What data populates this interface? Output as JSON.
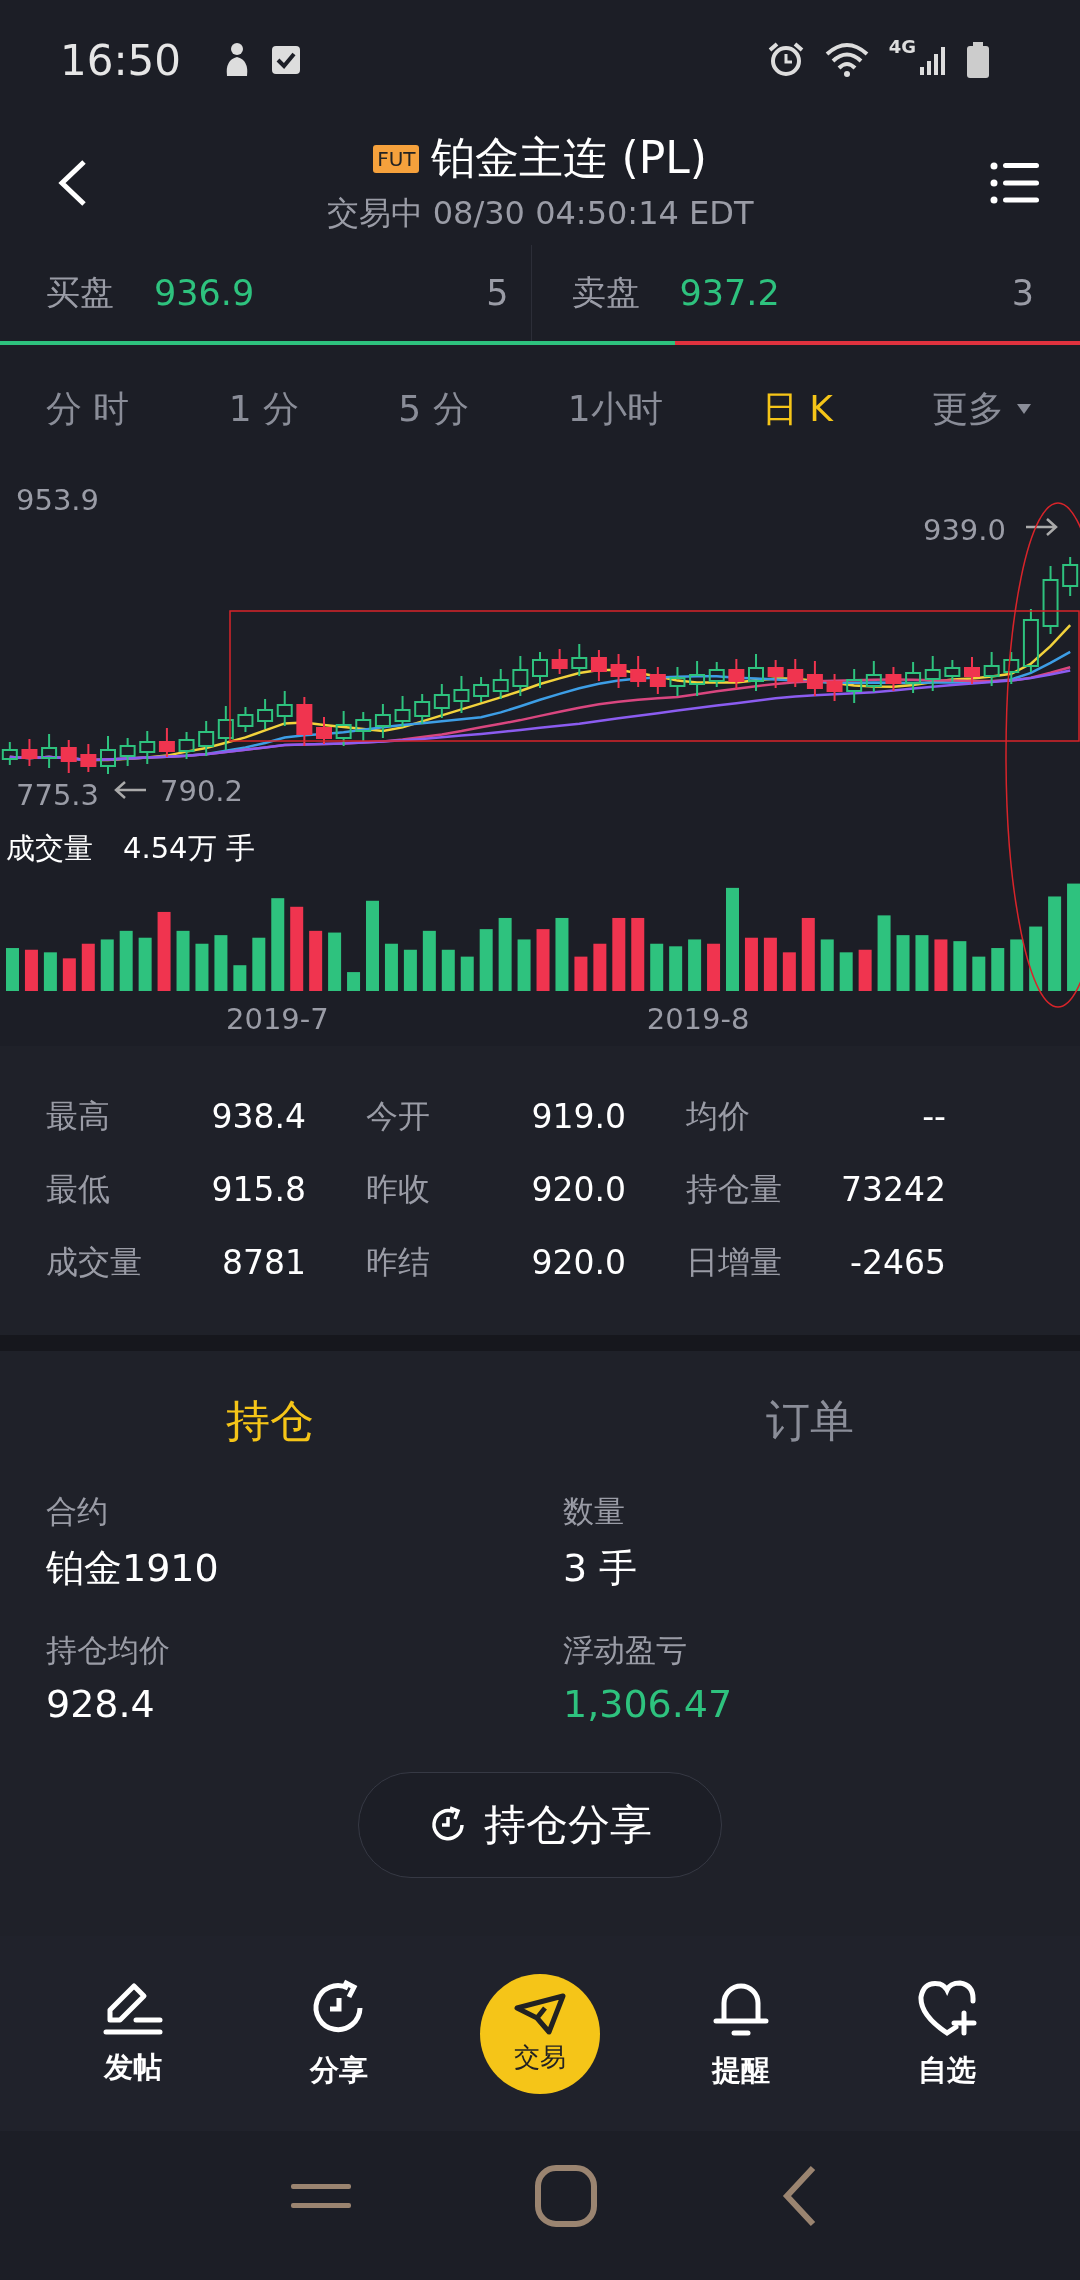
{
  "status_bar": {
    "time": "16:50",
    "network": "4G"
  },
  "header": {
    "badge": "FUT",
    "title": "铂金主连 (PL)",
    "subtitle": "交易中 08/30 04:50:14 EDT"
  },
  "quotes": [
    {
      "label": "买盘",
      "price": "936.9",
      "size": "5"
    },
    {
      "label": "卖盘",
      "price": "937.2",
      "size": "3"
    }
  ],
  "depth_bar": {
    "level": 0.625
  },
  "period_tabs": [
    {
      "label": "分 时",
      "selected": false,
      "kind": "plain"
    },
    {
      "label": "1 分",
      "selected": false,
      "kind": "plain"
    },
    {
      "label": "5 分",
      "selected": false,
      "kind": "plain"
    },
    {
      "label": "1小时",
      "selected": false,
      "kind": "plain"
    },
    {
      "label": "日 K",
      "selected": true,
      "kind": "plain"
    },
    {
      "label": "更多",
      "selected": false,
      "kind": "dropdown"
    }
  ],
  "chart": {
    "high_label": "953.9",
    "last_label": "939.0",
    "low_label": "775.3",
    "low_marker": "790.2",
    "volume_label": "成交量",
    "volume_value": "4.54万 手",
    "date_labels": [
      "2019-7",
      "2019-8"
    ]
  },
  "stats": [
    {
      "label": "最高",
      "value": "938.4"
    },
    {
      "label": "今开",
      "value": "919.0"
    },
    {
      "label": "均价",
      "value": "--"
    },
    {
      "label": "最低",
      "value": "915.8"
    },
    {
      "label": "昨收",
      "value": "920.0"
    },
    {
      "label": "持仓量",
      "value": "73242"
    },
    {
      "label": "成交量",
      "value": "8781"
    },
    {
      "label": "昨结",
      "value": "920.0"
    },
    {
      "label": "日增量",
      "value": "-2465"
    }
  ],
  "position_tabs": [
    {
      "label": "持仓",
      "selected": true
    },
    {
      "label": "订单",
      "selected": false
    }
  ],
  "position_fields": [
    {
      "label": "合约",
      "value": "铂金1910",
      "kind": "plain"
    },
    {
      "label": "数量",
      "value": "3 手",
      "kind": "plain"
    },
    {
      "label": "持仓均价",
      "value": "928.4",
      "kind": "plain"
    },
    {
      "label": "浮动盈亏",
      "value": "1,306.47",
      "kind": "profit"
    }
  ],
  "share_button": {
    "label": "持仓分享"
  },
  "bottom_nav": [
    {
      "label": "发帖",
      "kind": "post"
    },
    {
      "label": "分享",
      "kind": "share"
    },
    {
      "label": "交易",
      "kind": "trade"
    },
    {
      "label": "提醒",
      "kind": "alert"
    },
    {
      "label": "自选",
      "kind": "watch"
    }
  ]
}
